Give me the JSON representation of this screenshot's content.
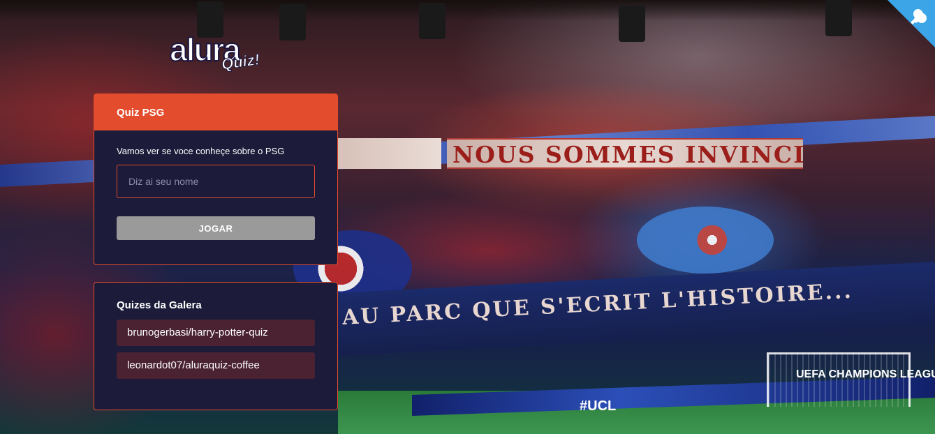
{
  "background": {
    "banner_top": "NOUS SOMMES INVINCIBLES",
    "banner_wall": "AU PARC QUE S'ECRIT L'HISTOIRE...",
    "ad_board": "#UCL",
    "goal_board": "UEFA CHAMPIONS LEAGUE"
  },
  "logo": {
    "main": "alura",
    "sub": "Quiz!"
  },
  "quiz_widget": {
    "title": "Quiz PSG",
    "description": "Vamos ver se voce conheçe sobre o PSG",
    "name_input": {
      "placeholder": "Diz ai seu nome",
      "value": ""
    },
    "play_button_label": "JOGAR"
  },
  "community_widget": {
    "title": "Quizes da Galera",
    "quizzes": [
      {
        "label": "brunogerbasi/harry-potter-quiz"
      },
      {
        "label": "leonardot07/aluraquiz-coffee"
      }
    ]
  },
  "github_corner": {
    "icon": "github-octocat-icon",
    "color": "#3ba5e8"
  },
  "colors": {
    "primary": "#e34c2c",
    "widget_bg": "#1c1b3a",
    "button_disabled": "#9a9a9a",
    "link_bg": "#4a2232"
  }
}
